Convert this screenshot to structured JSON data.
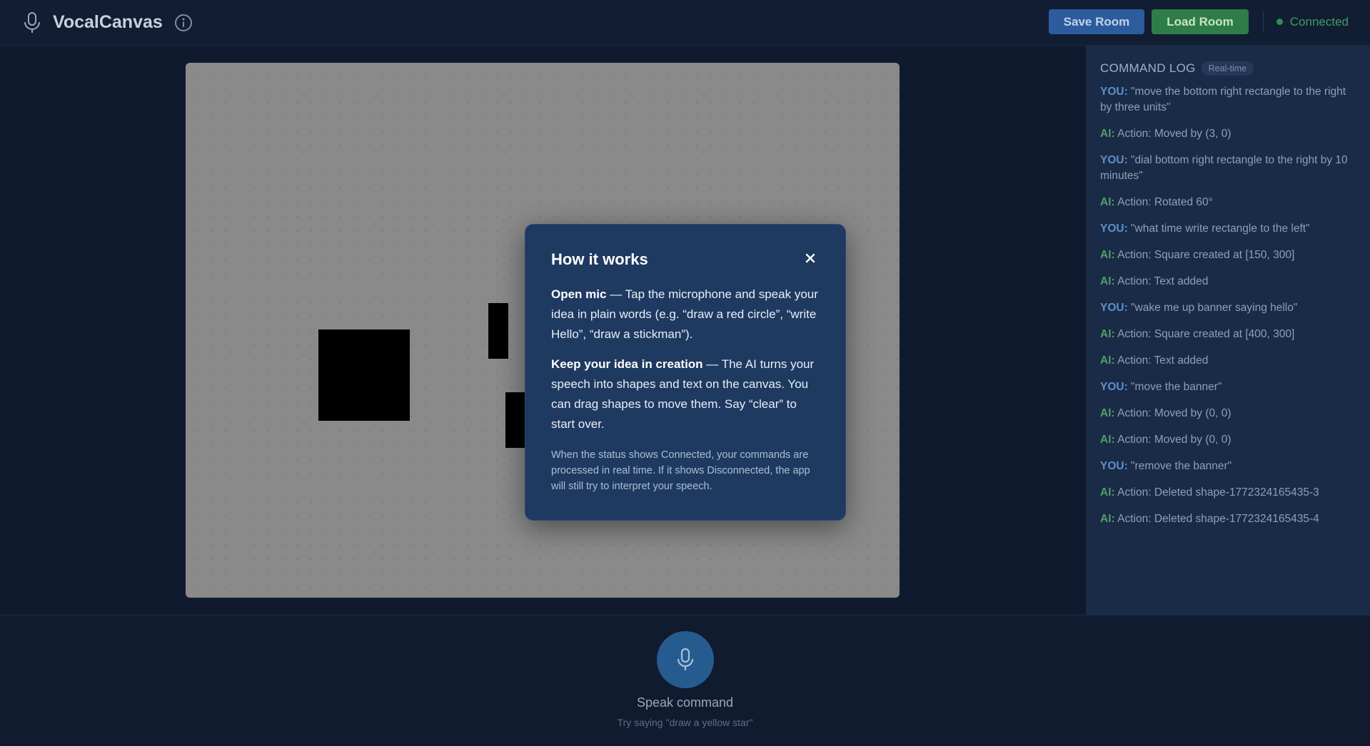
{
  "app": {
    "title": "VocalCanvas"
  },
  "header": {
    "save_label": "Save Room",
    "load_label": "Load Room",
    "status": "Connected"
  },
  "modal": {
    "title": "How it works",
    "close": "×",
    "p1_bold": "Open mic",
    "p1_text": " — Tap the microphone and speak your idea in plain words (e.g. “draw a red circle”, “write Hello”, “draw a stickman”).",
    "p2_bold": "Keep your idea in creation",
    "p2_text": " — The AI turns your speech into shapes and text on the canvas. You can drag shapes to move them. Say “clear” to start over.",
    "note": "When the status shows Connected, your commands are processed in real time. If it shows Disconnected, the app will still try to interpret your speech."
  },
  "log": {
    "title": "COMMAND LOG",
    "badge": "Real-time",
    "entries": [
      {
        "who": "YOU:",
        "text": " \"move the bottom right rectangle to the right by three units\""
      },
      {
        "who": "AI:",
        "text": " Action: Moved by (3, 0)"
      },
      {
        "who": "YOU:",
        "text": " \"dial bottom right rectangle to the right by 10 minutes\""
      },
      {
        "who": "AI:",
        "text": " Action: Rotated 60°"
      },
      {
        "who": "YOU:",
        "text": " \"what time write rectangle to the left\""
      },
      {
        "who": "AI:",
        "text": " Action: Square created at [150, 300]"
      },
      {
        "who": "AI:",
        "text": " Action: Text added"
      },
      {
        "who": "YOU:",
        "text": " \"wake me up banner saying hello\""
      },
      {
        "who": "AI:",
        "text": " Action: Square created at [400, 300]"
      },
      {
        "who": "AI:",
        "text": " Action: Text added"
      },
      {
        "who": "YOU:",
        "text": " \"move the banner\""
      },
      {
        "who": "AI:",
        "text": " Action: Moved by (0, 0)"
      },
      {
        "who": "AI:",
        "text": " Action: Moved by (0, 0)"
      },
      {
        "who": "YOU:",
        "text": " \"remove the banner\""
      },
      {
        "who": "AI:",
        "text": " Action: Deleted shape-1772324165435-3"
      },
      {
        "who": "AI:",
        "text": " Action: Deleted shape-1772324165435-4"
      }
    ]
  },
  "bottom": {
    "speak_label": "Speak command",
    "hint": "Try saying \"draw a yellow star\""
  },
  "colors": {
    "accent": "#2d5c9e",
    "success": "#2e7d46",
    "modal_bg": "#1f3a61"
  },
  "icons": {
    "logo": "microphone-icon",
    "info": "info-icon",
    "speak": "microphone-icon",
    "close": "close-icon"
  }
}
